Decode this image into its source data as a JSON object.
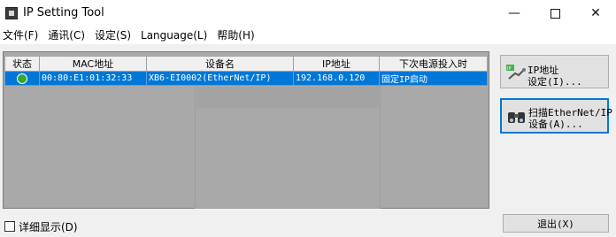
{
  "window": {
    "title": "IP Setting Tool",
    "controls": [
      "—",
      "□",
      "✕"
    ]
  },
  "menu": [
    {
      "label": "文件(F)"
    },
    {
      "label": "通讯(C)"
    },
    {
      "label": "设定(S)"
    },
    {
      "label": "Language(L)"
    },
    {
      "label": "帮助(H)"
    }
  ],
  "table": {
    "columns": [
      "状态",
      "MAC地址",
      "设备名",
      "IP地址",
      "下次电源投入时"
    ],
    "rows": [
      {
        "status_icon": "ok-circle-icon",
        "mac": "00:80:E1:01:32:33",
        "name": "XB6-EI0002(EtherNet/IP)",
        "ip": "192.168.0.120",
        "next_power": "固定IP启动"
      }
    ]
  },
  "buttons": {
    "ip_setting": {
      "label": "IP地址\n设定(I)...",
      "icon": "ip-network-icon"
    },
    "scan": {
      "label": "扫描EtherNet/IP\n设备(A)...",
      "icon": "binoculars-icon"
    },
    "exit": {
      "label": "退出(X)"
    }
  },
  "detail_checkbox": {
    "label": "详细显示(D)",
    "checked": false
  },
  "colors": {
    "selection": "#0078d7",
    "panel": "#a9a9a9",
    "status_ok": "#2fa82f"
  }
}
